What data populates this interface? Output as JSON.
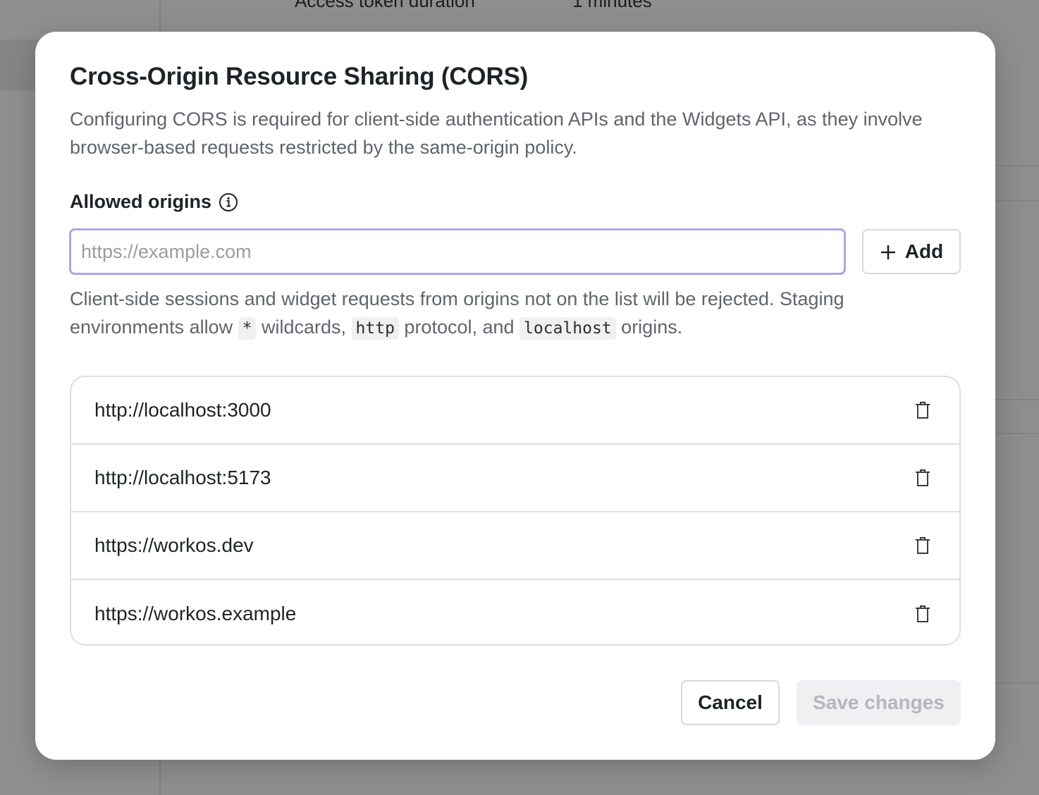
{
  "background": {
    "row_label": "Access token duration",
    "row_value": "1 minutes"
  },
  "modal": {
    "title": "Cross-Origin Resource Sharing (CORS)",
    "description": "Configuring CORS is required for client-side authentication APIs and the Widgets API, as they involve browser-based requests restricted by the same-origin policy.",
    "allowed_origins_label": "Allowed origins",
    "input_placeholder": "https://example.com",
    "input_value": "",
    "add_label": "Add",
    "help": {
      "part1": "Client-side sessions and widget requests from origins not on the list will be rejected. Staging environments allow ",
      "code1": "*",
      "part2": " wildcards, ",
      "code2": "http",
      "part3": " protocol, and ",
      "code3": "localhost",
      "part4": " origins."
    },
    "origins": [
      {
        "url": "http://localhost:3000"
      },
      {
        "url": "http://localhost:5173"
      },
      {
        "url": "https://workos.dev"
      },
      {
        "url": "https://workos.example"
      }
    ],
    "cancel_label": "Cancel",
    "save_label": "Save changes",
    "save_disabled": true
  },
  "icons": {
    "info": "info-circle-icon",
    "plus": "plus-icon",
    "delete": "trash-icon"
  },
  "colors": {
    "input_focus_border": "#a5a8e6",
    "text_primary": "#1f2328",
    "text_secondary": "#60646c",
    "disabled_text": "#b4b6bc"
  }
}
